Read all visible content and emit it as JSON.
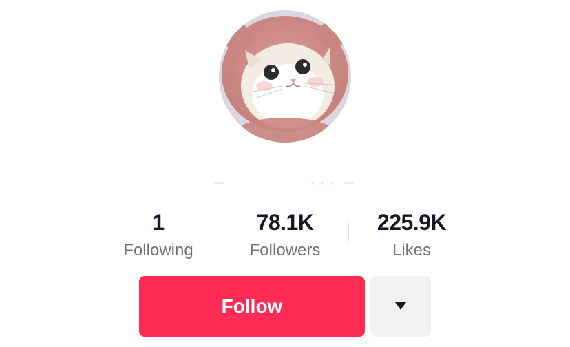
{
  "profile": {
    "avatar": {
      "icon": "cat-avatar-photo"
    }
  },
  "stats": {
    "following": {
      "value": "1",
      "label": "Following"
    },
    "followers": {
      "value": "78.1K",
      "label": "Followers"
    },
    "likes": {
      "value": "225.9K",
      "label": "Likes"
    }
  },
  "actions": {
    "follow_label": "Follow",
    "more_icon": "caret-down-icon"
  },
  "colors": {
    "follow_bg": "#fe2c55",
    "more_bg": "#f1f1f2",
    "value_text": "#161823",
    "label_text": "#737373"
  }
}
